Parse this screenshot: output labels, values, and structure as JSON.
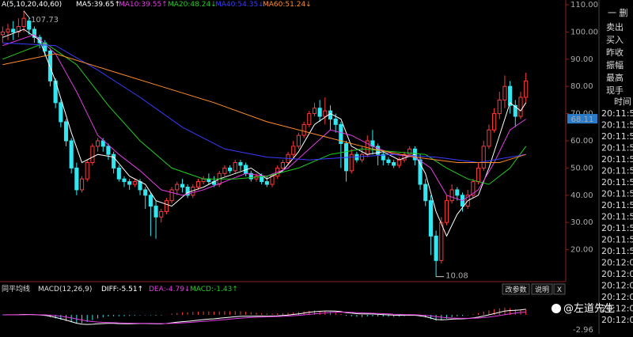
{
  "header": {
    "ma_prefix": "A(5,10,20,40,60)",
    "ma5": "MA5:39.65↑",
    "ma10": "MA10:39.55↑",
    "ma20": "MA20:48.24↓",
    "ma40": "MA40:54.35↓",
    "ma60": "MA60:51.24↓"
  },
  "macd_header": {
    "prefix": "同平均线",
    "macd": "MACD(12,26,9)",
    "diff": "DIFF:-5.51↑",
    "dea": "DEA:-4.79↓",
    "macd_val": "MACD:-1.43↑",
    "btn_params": "改参数",
    "btn_help": "说明",
    "btn_close": "X",
    "bottom_value": "-2.96"
  },
  "price_axis": {
    "ticks": [
      "110.00",
      "100.00",
      "90.00",
      "80.00",
      "70.00",
      "60.00",
      "50.00",
      "40.00",
      "30.00",
      "20.00"
    ],
    "current_price": "68.11"
  },
  "annotations": {
    "high": "107.73",
    "low": "10.08"
  },
  "side_panel": {
    "top": "一 删",
    "labels": [
      "卖出",
      "买入",
      "昨收",
      "振幅",
      "最高",
      "现手"
    ],
    "time_header": "时间",
    "times": [
      "20:11:5",
      "20:11:5",
      "20:11:5",
      "20:11:5",
      "20:11:5",
      "20:11:5",
      "20:11:5",
      "20:11:5",
      "20:11:5",
      "20:11:5",
      "20:11:5",
      "20:11:5",
      "20:11:5",
      "20:12:0",
      "20:12:0",
      "20:12:0",
      "20:12:0",
      "20:12:0",
      "20:12:0"
    ]
  },
  "watermark": "@左道先生",
  "colors": {
    "up": "#ff3a3a",
    "down": "#33e6f0",
    "ma5": "#ffffff",
    "ma10": "#e23ce2",
    "ma20": "#22cc22",
    "ma40": "#3a3aff",
    "ma60": "#ff8c2a"
  },
  "chart_data": {
    "type": "candlestick",
    "ylim": [
      10,
      110
    ],
    "candles": [
      [
        99,
        100,
        96,
        102
      ],
      [
        100,
        101,
        97,
        103
      ],
      [
        101,
        100,
        97,
        104
      ],
      [
        100,
        102,
        98,
        105
      ],
      [
        102,
        105,
        100,
        107.73
      ],
      [
        104,
        101,
        99,
        105
      ],
      [
        101,
        98,
        96,
        102
      ],
      [
        98,
        96,
        94,
        99
      ],
      [
        96,
        93,
        91,
        97
      ],
      [
        93,
        82,
        80,
        94
      ],
      [
        82,
        74,
        72,
        83
      ],
      [
        74,
        67,
        65,
        75
      ],
      [
        67,
        60,
        58,
        68
      ],
      [
        60,
        50,
        48,
        61
      ],
      [
        50,
        42,
        40,
        52
      ],
      [
        42,
        46,
        41,
        47
      ],
      [
        46,
        52,
        45,
        53
      ],
      [
        52,
        58,
        51,
        59
      ],
      [
        58,
        60,
        56,
        61
      ],
      [
        60,
        58,
        56,
        61
      ],
      [
        58,
        55,
        53,
        59
      ],
      [
        55,
        50,
        48,
        56
      ],
      [
        50,
        46,
        45,
        51
      ],
      [
        46,
        45,
        43,
        47
      ],
      [
        45,
        44,
        42,
        46
      ],
      [
        44,
        45,
        43,
        46
      ],
      [
        45,
        42,
        40,
        46
      ],
      [
        42,
        40,
        35,
        43
      ],
      [
        40,
        36,
        25,
        41
      ],
      [
        36,
        32,
        24,
        38
      ],
      [
        32,
        34,
        30,
        35
      ],
      [
        34,
        38,
        33,
        39
      ],
      [
        38,
        42,
        37,
        43
      ],
      [
        42,
        44,
        40,
        45
      ],
      [
        44,
        43,
        41,
        46
      ],
      [
        43,
        40,
        39,
        44
      ],
      [
        40,
        43,
        39,
        44
      ],
      [
        43,
        45,
        42,
        46
      ],
      [
        45,
        46,
        44,
        47
      ],
      [
        46,
        45,
        44,
        48
      ],
      [
        45,
        44,
        43,
        47
      ],
      [
        44,
        48,
        43,
        49
      ],
      [
        48,
        50,
        47,
        51
      ],
      [
        50,
        49,
        48,
        51
      ],
      [
        49,
        52,
        48,
        53
      ],
      [
        52,
        51,
        49,
        53
      ],
      [
        51,
        48,
        47,
        52
      ],
      [
        48,
        46,
        45,
        49
      ],
      [
        46,
        47,
        45,
        48
      ],
      [
        47,
        45,
        44,
        48
      ],
      [
        45,
        44,
        43,
        47
      ],
      [
        44,
        47,
        43,
        48
      ],
      [
        47,
        50,
        46,
        51
      ],
      [
        50,
        52,
        49,
        53
      ],
      [
        52,
        55,
        51,
        56
      ],
      [
        55,
        58,
        54,
        60
      ],
      [
        58,
        62,
        57,
        63
      ],
      [
        62,
        66,
        61,
        67
      ],
      [
        66,
        70,
        65,
        71
      ],
      [
        70,
        72,
        69,
        74
      ],
      [
        72,
        69,
        67,
        75
      ],
      [
        69,
        71,
        66,
        76
      ],
      [
        71,
        68,
        64,
        73
      ],
      [
        68,
        66,
        63,
        70
      ],
      [
        66,
        59,
        50,
        67
      ],
      [
        59,
        49,
        45,
        60
      ],
      [
        49,
        55,
        48,
        57
      ],
      [
        55,
        53,
        52,
        56
      ],
      [
        53,
        55,
        52,
        58
      ],
      [
        55,
        60,
        54,
        62
      ],
      [
        60,
        58,
        55,
        64
      ],
      [
        58,
        55,
        51,
        59
      ],
      [
        55,
        53,
        51,
        56
      ],
      [
        53,
        52,
        51,
        54
      ],
      [
        52,
        51,
        50,
        53
      ],
      [
        51,
        53,
        50,
        54
      ],
      [
        53,
        55,
        52,
        56
      ],
      [
        55,
        57,
        54,
        58
      ],
      [
        57,
        53,
        51,
        58
      ],
      [
        53,
        44,
        42,
        55
      ],
      [
        44,
        38,
        36,
        46
      ],
      [
        38,
        25,
        18,
        40
      ],
      [
        25,
        16,
        10.08,
        27
      ],
      [
        16,
        30,
        15,
        32
      ],
      [
        30,
        38,
        29,
        40
      ],
      [
        38,
        42,
        37,
        44
      ],
      [
        42,
        40,
        38,
        43
      ],
      [
        40,
        36,
        34,
        41
      ],
      [
        36,
        40,
        35,
        42
      ],
      [
        40,
        45,
        39,
        46
      ],
      [
        45,
        50,
        44,
        52
      ],
      [
        50,
        58,
        49,
        60
      ],
      [
        58,
        64,
        57,
        66
      ],
      [
        64,
        70,
        63,
        72
      ],
      [
        70,
        75,
        68,
        78
      ],
      [
        75,
        80,
        72,
        84
      ],
      [
        80,
        73,
        70,
        82
      ],
      [
        73,
        69,
        65,
        75
      ],
      [
        69,
        76,
        68,
        78
      ],
      [
        76,
        82,
        74,
        85
      ]
    ],
    "ma_series": [
      {
        "name": "MA5",
        "ma": 5,
        "values": [
          [
            0,
            98
          ],
          [
            4,
            101
          ],
          [
            7,
            97
          ],
          [
            10,
            82
          ],
          [
            13,
            63
          ],
          [
            15,
            52
          ],
          [
            18,
            55
          ],
          [
            21,
            54
          ],
          [
            24,
            47
          ],
          [
            27,
            44
          ],
          [
            29,
            38
          ],
          [
            32,
            36
          ],
          [
            35,
            41
          ],
          [
            38,
            43
          ],
          [
            41,
            46
          ],
          [
            44,
            48
          ],
          [
            47,
            50
          ],
          [
            50,
            46
          ],
          [
            53,
            49
          ],
          [
            56,
            56
          ],
          [
            59,
            66
          ],
          [
            62,
            70
          ],
          [
            64,
            68
          ],
          [
            66,
            58
          ],
          [
            69,
            55
          ],
          [
            72,
            56
          ],
          [
            75,
            53
          ],
          [
            78,
            55
          ],
          [
            80,
            48
          ],
          [
            82,
            34
          ],
          [
            84,
            25
          ],
          [
            86,
            33
          ],
          [
            88,
            38
          ],
          [
            90,
            40
          ],
          [
            92,
            50
          ],
          [
            94,
            62
          ],
          [
            96,
            74
          ],
          [
            98,
            71
          ],
          [
            99,
            74
          ]
        ]
      },
      {
        "name": "MA10",
        "ma": 10,
        "values": [
          [
            0,
            95
          ],
          [
            6,
            99
          ],
          [
            10,
            92
          ],
          [
            14,
            78
          ],
          [
            18,
            62
          ],
          [
            22,
            55
          ],
          [
            26,
            49
          ],
          [
            30,
            42
          ],
          [
            34,
            40
          ],
          [
            38,
            42
          ],
          [
            42,
            45
          ],
          [
            46,
            48
          ],
          [
            50,
            47
          ],
          [
            54,
            50
          ],
          [
            58,
            57
          ],
          [
            62,
            64
          ],
          [
            66,
            62
          ],
          [
            70,
            58
          ],
          [
            74,
            55
          ],
          [
            78,
            54
          ],
          [
            81,
            50
          ],
          [
            84,
            40
          ],
          [
            87,
            38
          ],
          [
            90,
            42
          ],
          [
            93,
            52
          ],
          [
            96,
            64
          ],
          [
            99,
            68
          ]
        ]
      },
      {
        "name": "MA20",
        "ma": 20,
        "values": [
          [
            0,
            90
          ],
          [
            8,
            96
          ],
          [
            14,
            88
          ],
          [
            20,
            73
          ],
          [
            26,
            60
          ],
          [
            32,
            50
          ],
          [
            38,
            46
          ],
          [
            44,
            46
          ],
          [
            50,
            47
          ],
          [
            56,
            50
          ],
          [
            62,
            55
          ],
          [
            68,
            57
          ],
          [
            74,
            56
          ],
          [
            80,
            55
          ],
          [
            84,
            50
          ],
          [
            88,
            46
          ],
          [
            92,
            44
          ],
          [
            96,
            50
          ],
          [
            99,
            58
          ]
        ]
      },
      {
        "name": "MA40",
        "ma": 40,
        "values": [
          [
            0,
            96
          ],
          [
            10,
            95
          ],
          [
            18,
            86
          ],
          [
            26,
            76
          ],
          [
            34,
            65
          ],
          [
            42,
            57
          ],
          [
            50,
            54
          ],
          [
            58,
            53
          ],
          [
            66,
            54
          ],
          [
            74,
            55
          ],
          [
            82,
            54
          ],
          [
            90,
            52
          ],
          [
            99,
            55
          ]
        ]
      },
      {
        "name": "MA60",
        "ma": 60,
        "values": [
          [
            0,
            88
          ],
          [
            10,
            92
          ],
          [
            20,
            86
          ],
          [
            30,
            80
          ],
          [
            40,
            74
          ],
          [
            50,
            67
          ],
          [
            60,
            62
          ],
          [
            70,
            57
          ],
          [
            78,
            54
          ],
          [
            86,
            52
          ],
          [
            94,
            52
          ],
          [
            99,
            55
          ]
        ]
      }
    ]
  }
}
